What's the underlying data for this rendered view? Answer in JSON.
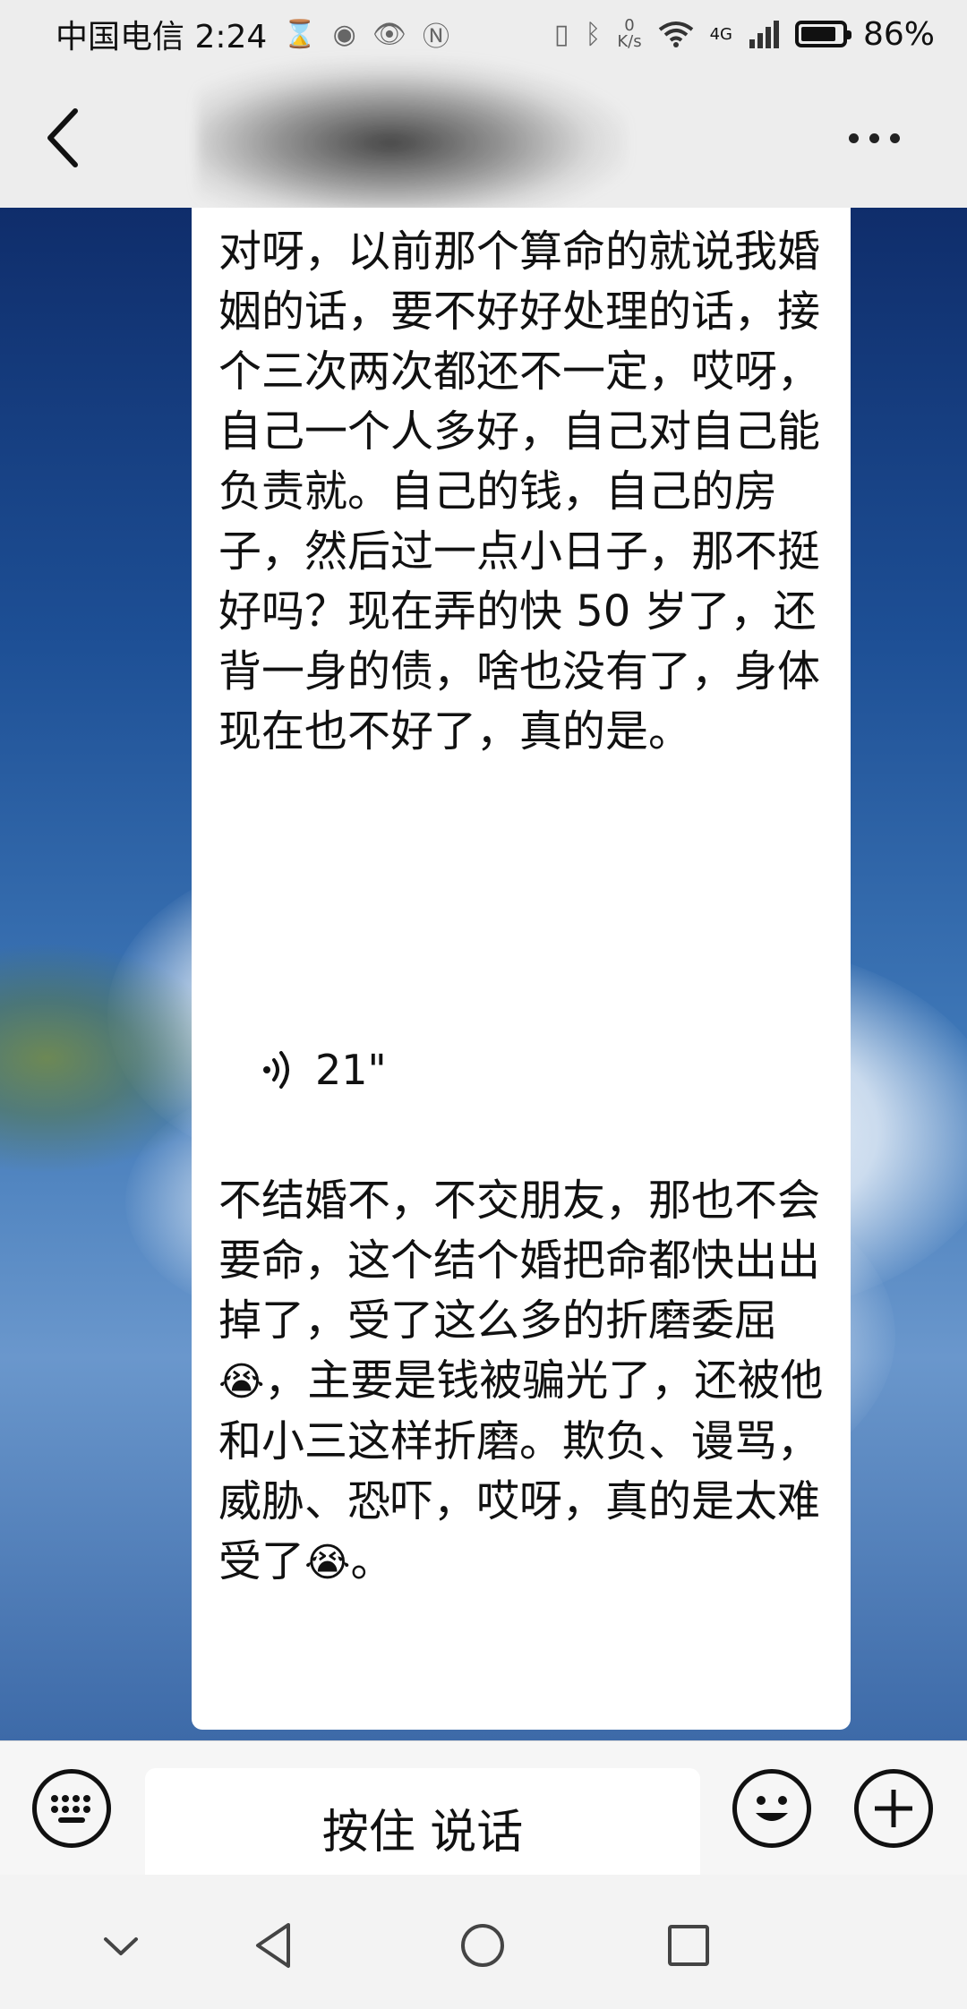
{
  "status_bar": {
    "carrier_time": "中国电信 2:24",
    "net_speed_value": "0",
    "net_speed_unit": "K/s",
    "signal_label": "4G",
    "battery_percent": "86%",
    "battery_level": 0.86
  },
  "title_bar": {
    "back_icon": "chevron-left-icon",
    "more_icon": "more-dots-icon"
  },
  "messages": [
    {
      "type": "text",
      "text": "对呀，以前那个算命的就说我婚姻的话，要不好好处理的话，接个三次两次都还不一定，哎呀，自己一个人多好，自己对自己能负责就。自己的钱，自己的房子，然后过一点小日子，那不挺好吗？现在弄的快 50 岁了，还背一身的债，啥也没有了，身体现在也不好了，真的是。"
    },
    {
      "type": "voice",
      "duration": "21\""
    },
    {
      "type": "text",
      "text_part1": "不结婚不，不交朋友，那也不会要命，这个结个婚把命都快出出掉了，受了这么多的折磨委屈",
      "emoji1": "😭",
      "text_part2": "，主要是钱被骗光了，还被他和小三这样折磨。欺负、谩骂，威胁、恐吓，哎呀，真的是太难受了",
      "emoji2": "😭",
      "text_part3": "。"
    }
  ],
  "input_bar": {
    "hold_to_talk_label": "按住 说话",
    "keyboard_icon": "keyboard-icon",
    "emoji_icon": "smile-icon",
    "plus_icon": "plus-icon"
  },
  "nav_bar": {
    "icons": [
      "chevron-down-icon",
      "back-triangle-icon",
      "home-circle-icon",
      "recents-square-icon"
    ]
  }
}
